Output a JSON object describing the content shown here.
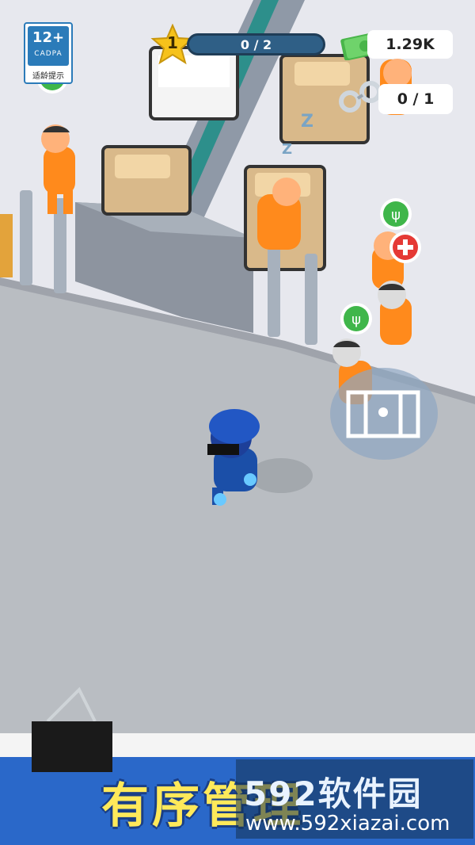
{
  "hud": {
    "level": "1",
    "level_progress": "0 / 2",
    "money": "1.29K",
    "handcuffs": "0 / 1"
  },
  "age_rating": {
    "rating": "12+",
    "org": "CADPA",
    "tip": "适龄提示"
  },
  "banner": {
    "title": "有序管理"
  },
  "watermark": {
    "brand": "592软件园",
    "url": "www.592xiazai.com"
  },
  "icons": [
    "money-icon",
    "handcuffs-icon",
    "star-icon",
    "food-icon",
    "medical-icon",
    "cell-door-icon",
    "binder-clip-icon"
  ],
  "colors": {
    "floor": "#b9bdc2",
    "prisoner": "#ff8a1c",
    "police": "#1b4fa8",
    "hud_bar": "#2f5f86",
    "star": "#f6c21b",
    "money": "#49b54a"
  }
}
